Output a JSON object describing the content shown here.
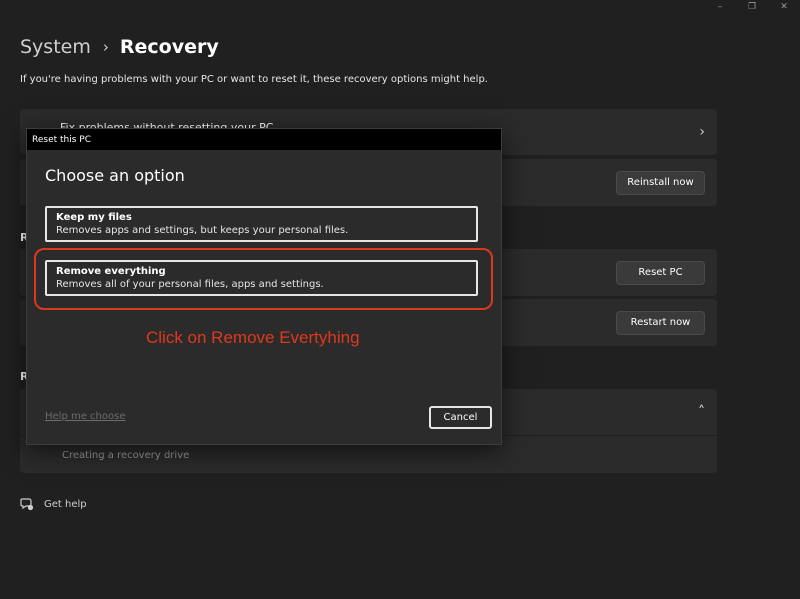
{
  "window": {
    "minimize_glyph": "–",
    "maximize_glyph": "❐",
    "close_glyph": "✕"
  },
  "breadcrumb": {
    "parent": "System",
    "separator": "›",
    "current": "Recovery"
  },
  "subtitle": "If you're having problems with your PC or want to reset it, these recovery options might help.",
  "cards": {
    "fix_problems": {
      "label": "Fix problems without resetting your PC",
      "chevron": "›"
    },
    "reinstall": {
      "button": "Reinstall now"
    },
    "reset": {
      "button": "Reset PC"
    },
    "restart": {
      "button": "Restart now"
    },
    "related": {
      "chevron": "˄",
      "sub_item": "Creating a recovery drive"
    }
  },
  "section_letters": {
    "recovery_options": "R",
    "related_support": "R"
  },
  "get_help": {
    "icon": "chat-help-icon",
    "label": "Get help"
  },
  "dialog": {
    "title": "Reset this PC",
    "heading": "Choose an option",
    "options": [
      {
        "title": "Keep my files",
        "description": "Removes apps and settings, but keeps your personal files."
      },
      {
        "title": "Remove everything",
        "description": "Removes all of your personal files, apps and settings."
      }
    ],
    "help_link": "Help me choose",
    "cancel": "Cancel"
  },
  "annotation": {
    "text": "Click on Remove Evertyhing",
    "color": "#e0381c"
  },
  "colors": {
    "background": "#202020",
    "card": "#2b2b2b",
    "highlight": "#d93a1e"
  }
}
